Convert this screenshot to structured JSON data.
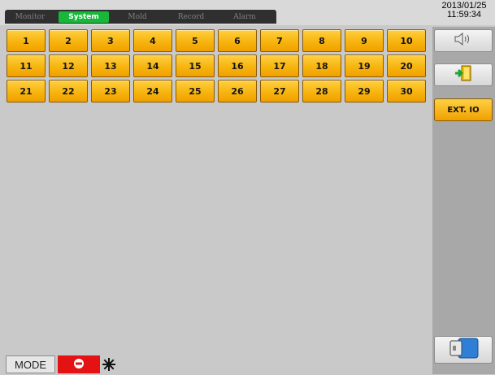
{
  "header": {
    "tabs": [
      {
        "label": "Monitor",
        "active": false
      },
      {
        "label": "System",
        "active": true
      },
      {
        "label": "Mold",
        "active": false
      },
      {
        "label": "Record",
        "active": false
      },
      {
        "label": "Alarm",
        "active": false
      }
    ],
    "date": "2013/01/25",
    "time": "11:59:34"
  },
  "grid": {
    "rows": [
      [
        "1",
        "2",
        "3",
        "4",
        "5",
        "6",
        "7",
        "8",
        "9",
        "10"
      ],
      [
        "11",
        "12",
        "13",
        "14",
        "15",
        "16",
        "17",
        "18",
        "19",
        "20"
      ],
      [
        "21",
        "22",
        "23",
        "24",
        "25",
        "26",
        "27",
        "28",
        "29",
        "30"
      ]
    ]
  },
  "side_panel": {
    "sound_icon": "speaker-icon",
    "exit_icon": "exit-door-icon",
    "ext_label": "EXT. IO",
    "card_icon": "card-icon"
  },
  "status": {
    "mode_label": "MODE",
    "alarm_icon": "stop-icon",
    "activity_icon": "gear-spinner-icon",
    "alarm_color": "#e41212",
    "accent_tab_color": "#18b73c",
    "button_color": "#f7b40f"
  }
}
